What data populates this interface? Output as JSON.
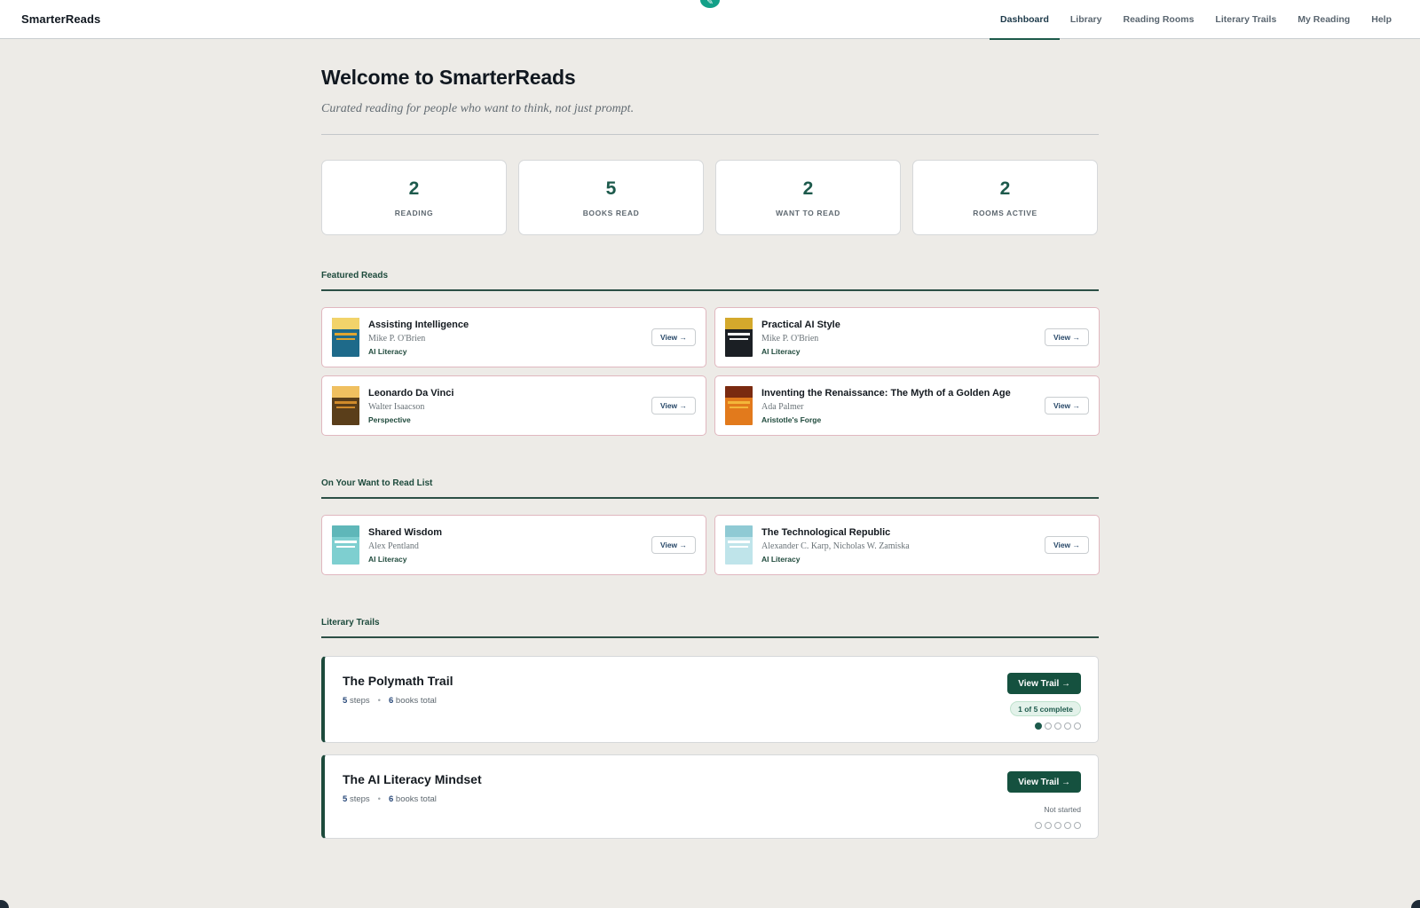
{
  "app": {
    "brand": "SmarterReads",
    "nav": [
      {
        "label": "Dashboard",
        "active": true
      },
      {
        "label": "Library",
        "active": false
      },
      {
        "label": "Reading Rooms",
        "active": false
      },
      {
        "label": "Literary Trails",
        "active": false
      },
      {
        "label": "My Reading",
        "active": false
      },
      {
        "label": "Help",
        "active": false
      }
    ],
    "accent_color": "#1d5a4c",
    "badge_icon": "pencil-icon"
  },
  "header": {
    "title": "Welcome to SmarterReads",
    "subtitle": "Curated reading for people who want to think, not just prompt."
  },
  "stats": [
    {
      "value": "2",
      "label": "READING"
    },
    {
      "value": "5",
      "label": "BOOKS READ"
    },
    {
      "value": "2",
      "label": "WANT TO READ"
    },
    {
      "value": "2",
      "label": "ROOMS ACTIVE"
    }
  ],
  "featured": {
    "title": "Featured Reads",
    "books": [
      {
        "title": "Assisting Intelligence",
        "author": "Mike P. O'Brien",
        "tag": "AI Literacy",
        "view": "View →",
        "cover": [
          "#1e6a8a",
          "#e0a530",
          "#f2d36a"
        ]
      },
      {
        "title": "Practical AI Style",
        "author": "Mike P. O'Brien",
        "tag": "AI Literacy",
        "view": "View →",
        "cover": [
          "#1b1f24",
          "#f4f4f4",
          "#d4a92c"
        ]
      },
      {
        "title": "Leonardo Da Vinci",
        "author": "Walter Isaacson",
        "tag": "Perspective",
        "view": "View →",
        "cover": [
          "#5a3e1a",
          "#d08a2a",
          "#f0c060"
        ]
      },
      {
        "title": "Inventing the Renaissance: The Myth of a Golden Age",
        "author": "Ada Palmer",
        "tag": "Aristotle's Forge",
        "view": "View →",
        "cover": [
          "#e27a1c",
          "#f3b63a",
          "#7a2a10"
        ]
      }
    ]
  },
  "want_to_read": {
    "title": "On Your Want to Read List",
    "books": [
      {
        "title": "Shared Wisdom",
        "author": "Alex Pentland",
        "tag": "AI Literacy",
        "view": "View →",
        "cover": [
          "#7ecfd0",
          "#ffffff",
          "#5fb7b9"
        ]
      },
      {
        "title": "The Technological Republic",
        "author": "Alexander C. Karp, Nicholas W. Zamiska",
        "tag": "AI Literacy",
        "view": "View →",
        "cover": [
          "#bfe4ea",
          "#ffffff",
          "#8fcad4"
        ]
      }
    ]
  },
  "trails": {
    "title": "Literary Trails",
    "items": [
      {
        "title": "The Polymath Trail",
        "steps": "5",
        "steps_label": "steps",
        "books": "6",
        "books_label": "books total",
        "button": "View Trail →",
        "status": "1 of 5 complete",
        "completed_steps": 1,
        "total_steps": 5
      },
      {
        "title": "The AI Literacy Mindset",
        "steps": "5",
        "steps_label": "steps",
        "books": "6",
        "books_label": "books total",
        "button": "View Trail →",
        "status": "Not started",
        "completed_steps": 0,
        "total_steps": 5
      }
    ]
  }
}
